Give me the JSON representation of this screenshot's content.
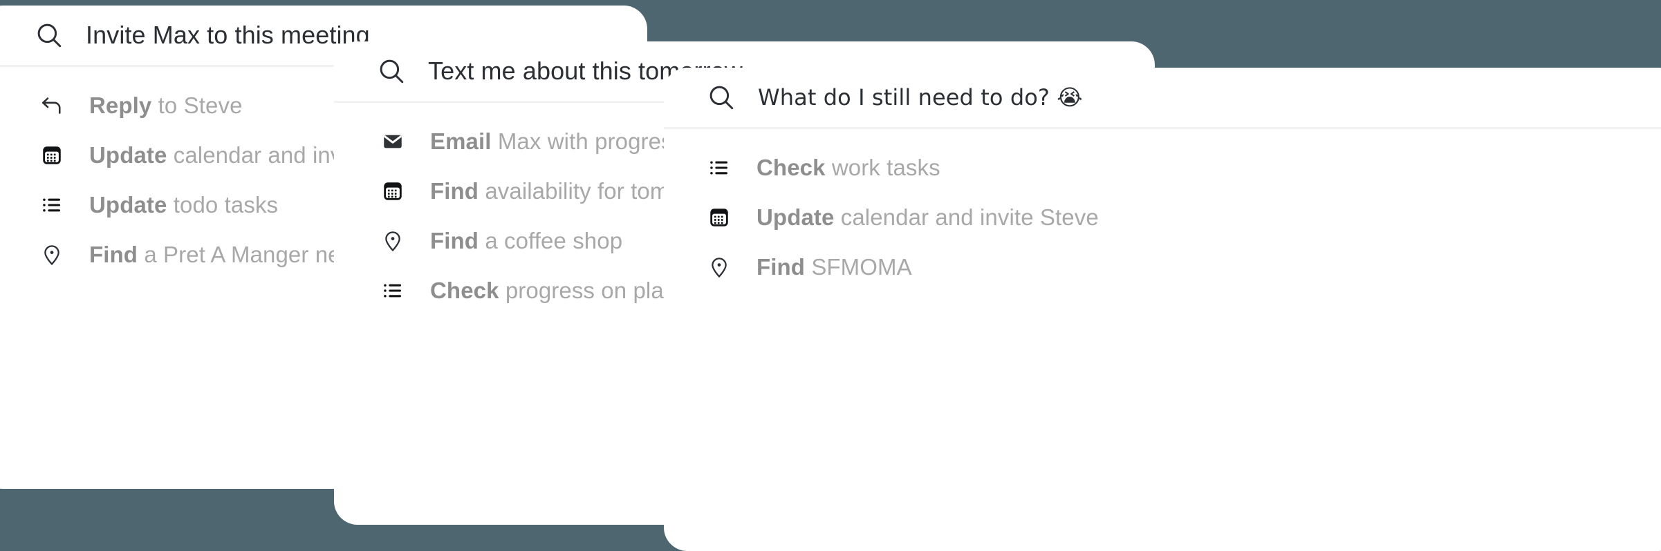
{
  "theme": {
    "background_color": "#4d6670",
    "panel_color": "#ffffff",
    "query_text_color": "#2b2f33",
    "result_text_color": "#a8a8a8",
    "result_verb_color": "#8e8e8e",
    "divider_color": "#f2f2f2"
  },
  "panels": [
    {
      "id": "panel-1",
      "search": {
        "icon": "search-icon",
        "query": "Invite Max to this meeting"
      },
      "results": [
        {
          "icon": "reply-icon",
          "verb": "Reply",
          "rest": " to Steve"
        },
        {
          "icon": "calendar-icon",
          "verb": "Update",
          "rest": " calendar and invite Steve"
        },
        {
          "icon": "list-icon",
          "verb": "Update",
          "rest": " todo tasks"
        },
        {
          "icon": "pin-icon",
          "verb": "Find",
          "rest": " a Pret A Manger nearby"
        }
      ]
    },
    {
      "id": "panel-2",
      "search": {
        "icon": "search-icon",
        "query": "Text me about this tomorrow"
      },
      "results": [
        {
          "icon": "envelope-icon",
          "verb": "Email",
          "rest": " Max with progress"
        },
        {
          "icon": "calendar-icon",
          "verb": "Find",
          "rest": " availability for tomorrow"
        },
        {
          "icon": "pin-icon",
          "verb": "Find",
          "rest": " a coffee shop"
        },
        {
          "icon": "list-icon",
          "verb": "Check",
          "rest": " progress on plants"
        }
      ]
    },
    {
      "id": "panel-3",
      "search": {
        "icon": "search-icon",
        "query": "What do I still need to do? 😭"
      },
      "results": [
        {
          "icon": "list-icon",
          "verb": "Check",
          "rest": " work tasks"
        },
        {
          "icon": "calendar-icon",
          "verb": "Update",
          "rest": " calendar and invite Steve"
        },
        {
          "icon": "pin-icon",
          "verb": "Find",
          "rest": " SFMOMA"
        }
      ]
    }
  ]
}
